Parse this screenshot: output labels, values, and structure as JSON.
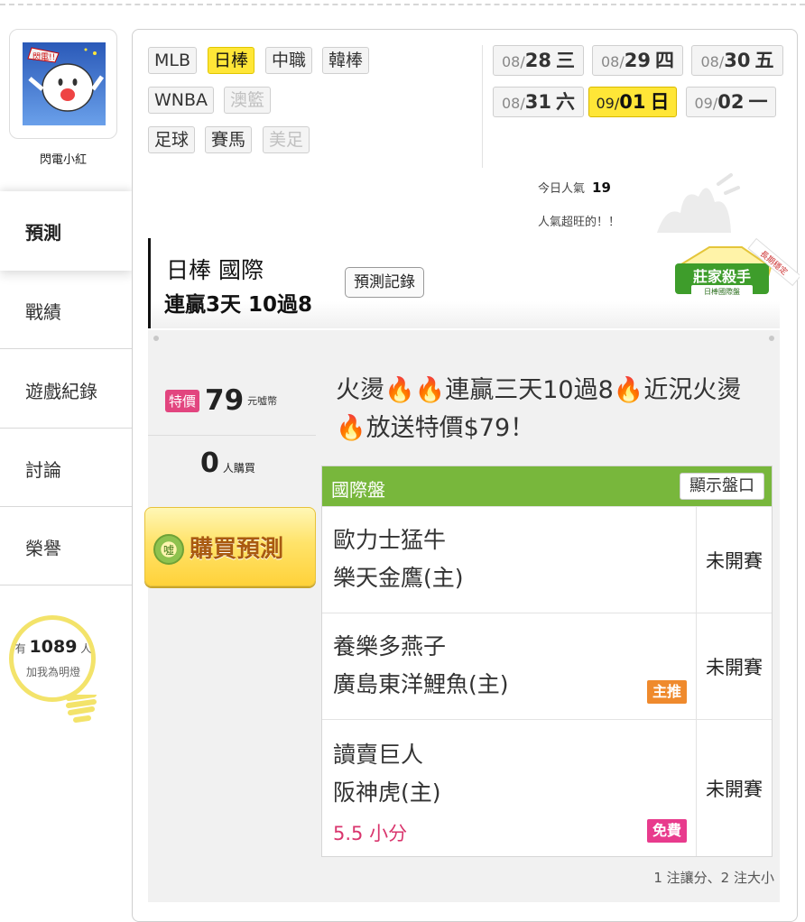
{
  "user": {
    "name": "閃電小紅",
    "avatar_text": "閃電!!"
  },
  "sidebar": {
    "items": [
      {
        "label": "預測"
      },
      {
        "label": "戰績"
      },
      {
        "label": "遊戲紀錄"
      },
      {
        "label": "討論"
      },
      {
        "label": "榮譽"
      }
    ],
    "active_index": 0
  },
  "fans": {
    "prefix": "有",
    "count": "1089",
    "unit": "人",
    "subtitle": "加我為明燈"
  },
  "sports": {
    "row1": [
      "MLB",
      "日棒",
      "中職",
      "韓棒"
    ],
    "row2": [
      "WNBA",
      "澳籃"
    ],
    "row3": [
      "足球",
      "賽馬",
      "美足"
    ],
    "active": "日棒",
    "disabled": [
      "澳籃",
      "美足"
    ]
  },
  "dates": [
    {
      "month": "08/",
      "day": "28",
      "weekday": "三",
      "active": false
    },
    {
      "month": "08/",
      "day": "29",
      "weekday": "四",
      "active": false
    },
    {
      "month": "08/",
      "day": "30",
      "weekday": "五",
      "active": false
    },
    {
      "month": "08/",
      "day": "31",
      "weekday": "六",
      "active": false
    },
    {
      "month": "09/",
      "day": "01",
      "weekday": "日",
      "active": true
    },
    {
      "month": "09/",
      "day": "02",
      "weekday": "一",
      "active": false
    }
  ],
  "popularity": {
    "label": "今日人氣",
    "value": "19",
    "note": "人氣超旺的！！"
  },
  "header": {
    "league": "日棒 國際",
    "streak": "連贏3天 10過8",
    "record_button": "預測記錄",
    "badge_main": "莊家殺手",
    "badge_sub": "日棒國際盤",
    "badge_ribbon": "長期穩定"
  },
  "pricing": {
    "tag": "特價",
    "price": "79",
    "price_unit": "元噓幣",
    "buyers": "0",
    "buyers_unit": "人購買",
    "buy_button": "購買預測",
    "coin_text": "噓"
  },
  "promo_text": "火燙🔥🔥連贏三天10過8🔥近況火燙🔥放送特價$79！",
  "table": {
    "title": "國際盤",
    "show_button": "顯示盤口",
    "games": [
      {
        "away": "歐力士猛牛",
        "home": "樂天金鷹(主)",
        "status": "未開賽",
        "tag": "",
        "handicap": ""
      },
      {
        "away": "養樂多燕子",
        "home": "廣島東洋鯉魚(主)",
        "status": "未開賽",
        "tag": "主推",
        "handicap": ""
      },
      {
        "away": "讀賣巨人",
        "home": "阪神虎(主)",
        "status": "未開賽",
        "tag": "免費",
        "handicap": "5.5 小分"
      }
    ],
    "footnote": "1 注讓分、2 注大小"
  },
  "colors": {
    "accent_yellow": "#ffe637",
    "table_green": "#78b73c",
    "special_pink": "#e2457f",
    "main_orange": "#ef8a2d"
  }
}
